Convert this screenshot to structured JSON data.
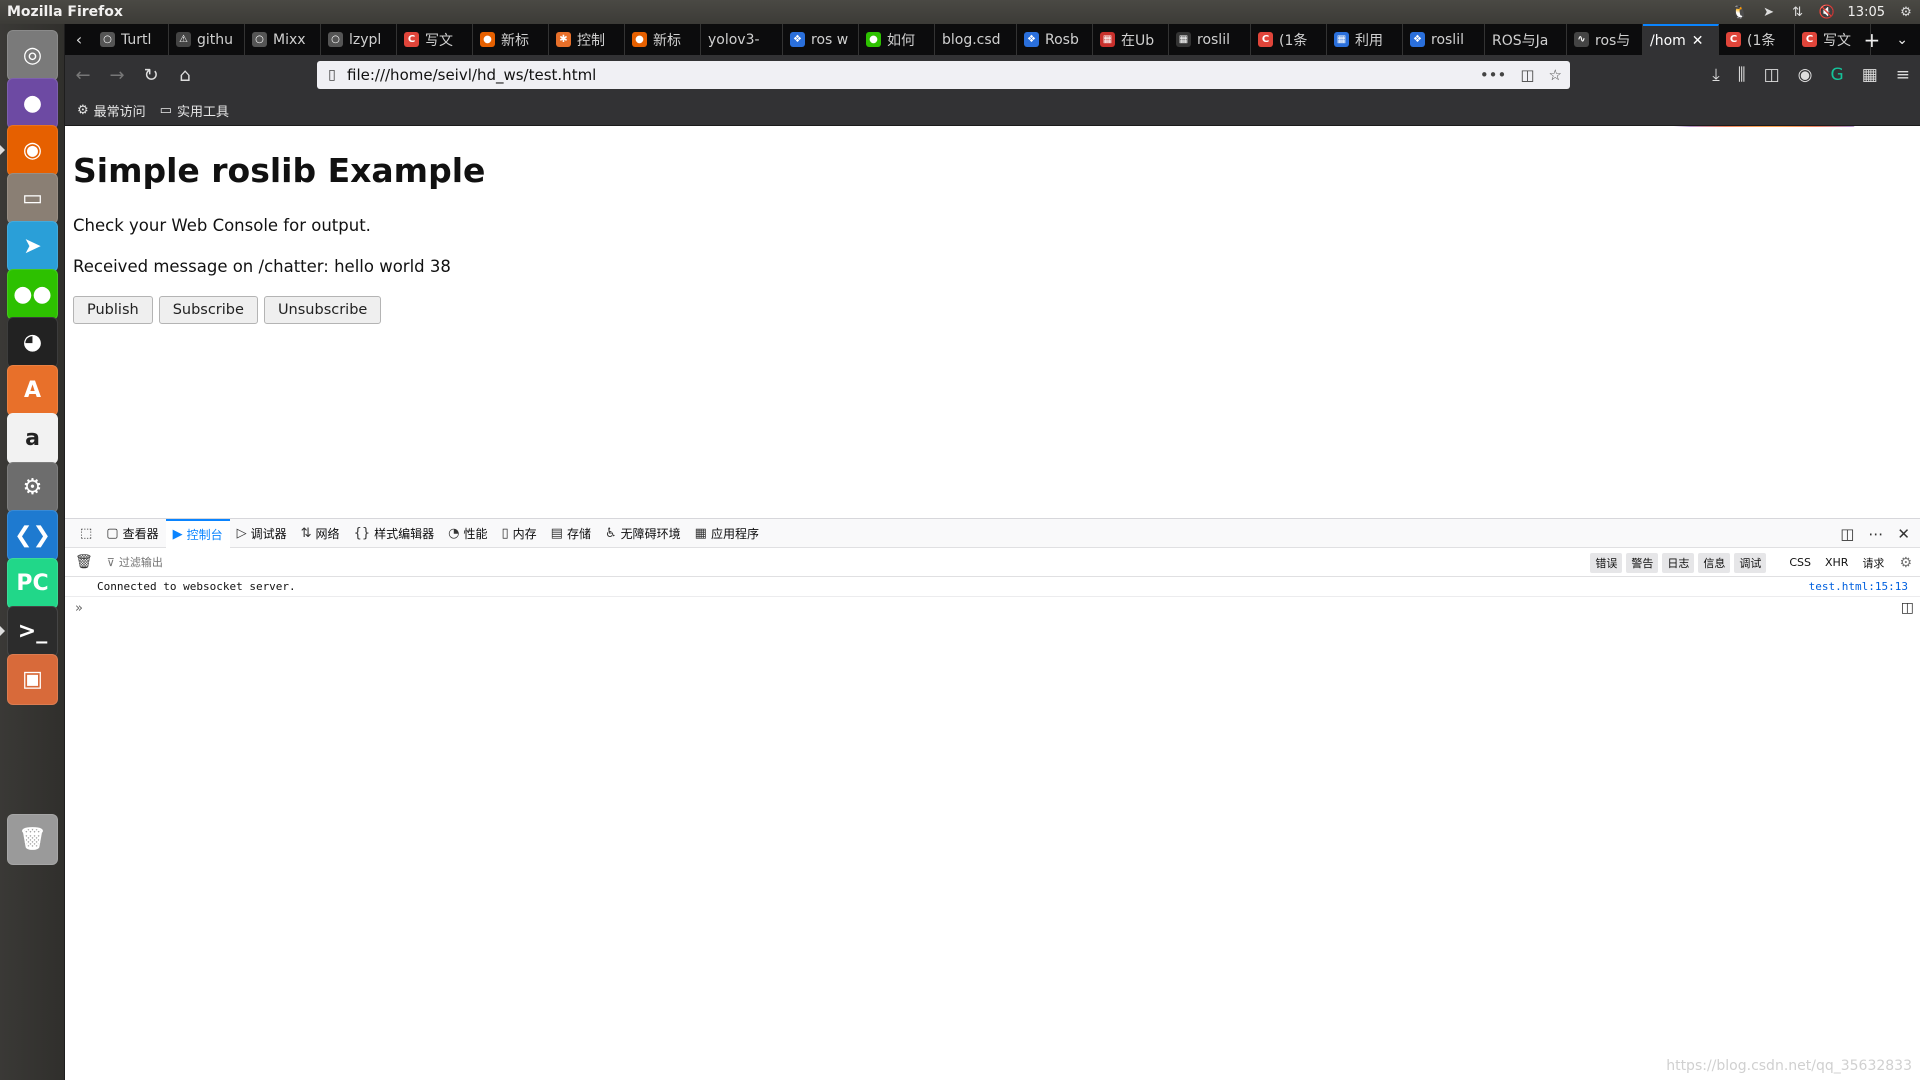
{
  "window_title": "Mozilla Firefox",
  "indicators": {
    "clock": "13:05"
  },
  "launcher": [
    {
      "name": "dash-icon",
      "glyph": "◎",
      "color": "#7a7a7a"
    },
    {
      "name": "video-player-icon",
      "glyph": "●",
      "color": "#6d4aa3"
    },
    {
      "name": "firefox-icon",
      "glyph": "◉",
      "color": "#e66000"
    },
    {
      "name": "files-icon",
      "glyph": "▭",
      "color": "#8a7f74"
    },
    {
      "name": "telegram-icon",
      "glyph": "➤",
      "color": "#2a9fd8"
    },
    {
      "name": "wechat-icon",
      "glyph": "●●",
      "color": "#2dc100"
    },
    {
      "name": "qq-icon",
      "glyph": "◕",
      "color": "#222222"
    },
    {
      "name": "software-center-icon",
      "glyph": "A",
      "color": "#e8702a"
    },
    {
      "name": "amazon-icon",
      "glyph": "a",
      "color": "#f2f2f2"
    },
    {
      "name": "system-settings-icon",
      "glyph": "⚙",
      "color": "#6d6d6d"
    },
    {
      "name": "vscode-icon",
      "glyph": "❮❯",
      "color": "#1e7ad0"
    },
    {
      "name": "pycharm-icon",
      "glyph": "PC",
      "color": "#21d789"
    },
    {
      "name": "terminal-icon",
      "glyph": ">_",
      "color": "#2c2c2c"
    },
    {
      "name": "archive-manager-icon",
      "glyph": "▣",
      "color": "#d86a3a"
    },
    {
      "name": "trash-icon",
      "glyph": "🗑",
      "color": "#9a9a9a"
    }
  ],
  "tabs": [
    {
      "title": "Turtl",
      "fav": "○",
      "color": "#555"
    },
    {
      "title": "githu",
      "fav": "⚠",
      "color": "#444"
    },
    {
      "title": "Mixx",
      "fav": "○",
      "color": "#555"
    },
    {
      "title": "lzypl",
      "fav": "○",
      "color": "#555"
    },
    {
      "title": "写文",
      "fav": "C",
      "color": "#e0453a"
    },
    {
      "title": "新标",
      "fav": "●",
      "color": "#e66000"
    },
    {
      "title": "控制",
      "fav": "✱",
      "color": "#e8702a"
    },
    {
      "title": "新标",
      "fav": "●",
      "color": "#e66000"
    },
    {
      "title": "yolov3-",
      "fav": "",
      "color": "#0c0c0d"
    },
    {
      "title": "ros w",
      "fav": "❖",
      "color": "#2a6fdb"
    },
    {
      "title": "如何",
      "fav": "●",
      "color": "#2dc100"
    },
    {
      "title": "blog.csd",
      "fav": "",
      "color": "#0c0c0d"
    },
    {
      "title": "Rosb",
      "fav": "❖",
      "color": "#2a6fdb"
    },
    {
      "title": "在Ub",
      "fav": "▦",
      "color": "#c9302c"
    },
    {
      "title": "roslil",
      "fav": "▦",
      "color": "#333"
    },
    {
      "title": "(1条",
      "fav": "C",
      "color": "#e0453a"
    },
    {
      "title": "利用",
      "fav": "▦",
      "color": "#2a6fdb"
    },
    {
      "title": "roslil",
      "fav": "❖",
      "color": "#2a6fdb"
    },
    {
      "title": "ROS与Ja",
      "fav": "",
      "color": "#0c0c0d"
    },
    {
      "title": "ros与",
      "fav": "∿",
      "color": "#444"
    },
    {
      "title": "/hom",
      "fav": "",
      "color": "#0c0c0d",
      "active": true
    },
    {
      "title": "(1条",
      "fav": "C",
      "color": "#e0453a"
    },
    {
      "title": "写文",
      "fav": "C",
      "color": "#e0453a"
    }
  ],
  "url": "file:///home/seivl/hd_ws/test.html",
  "bookmarks": [
    {
      "label": "最常访问",
      "icon": "⚙"
    },
    {
      "label": "实用工具",
      "icon": "▭"
    }
  ],
  "page": {
    "heading": "Simple roslib Example",
    "line1": "Check your Web Console for output.",
    "line2": "Received message on /chatter: hello world 38",
    "buttons": {
      "publish": "Publish",
      "subscribe": "Subscribe",
      "unsubscribe": "Unsubscribe"
    }
  },
  "devtools": {
    "tabs": [
      {
        "label": "查看器",
        "icon": "▢"
      },
      {
        "label": "控制台",
        "icon": "▶",
        "active": true
      },
      {
        "label": "调试器",
        "icon": "▷"
      },
      {
        "label": "网络",
        "icon": "⇅"
      },
      {
        "label": "样式编辑器",
        "icon": "{}"
      },
      {
        "label": "性能",
        "icon": "◔"
      },
      {
        "label": "内存",
        "icon": "▯"
      },
      {
        "label": "存储",
        "icon": "▤"
      },
      {
        "label": "无障碍环境",
        "icon": "♿"
      },
      {
        "label": "应用程序",
        "icon": "▦"
      }
    ],
    "filter_placeholder": "过滤输出",
    "filter_chips": [
      "错误",
      "警告",
      "日志",
      "信息",
      "调试"
    ],
    "filter_plain": [
      "CSS",
      "XHR",
      "请求"
    ],
    "log": {
      "message": "Connected to websocket server.",
      "source": "test.html:15:13"
    }
  },
  "watermark": "https://blog.csdn.net/qq_35632833"
}
